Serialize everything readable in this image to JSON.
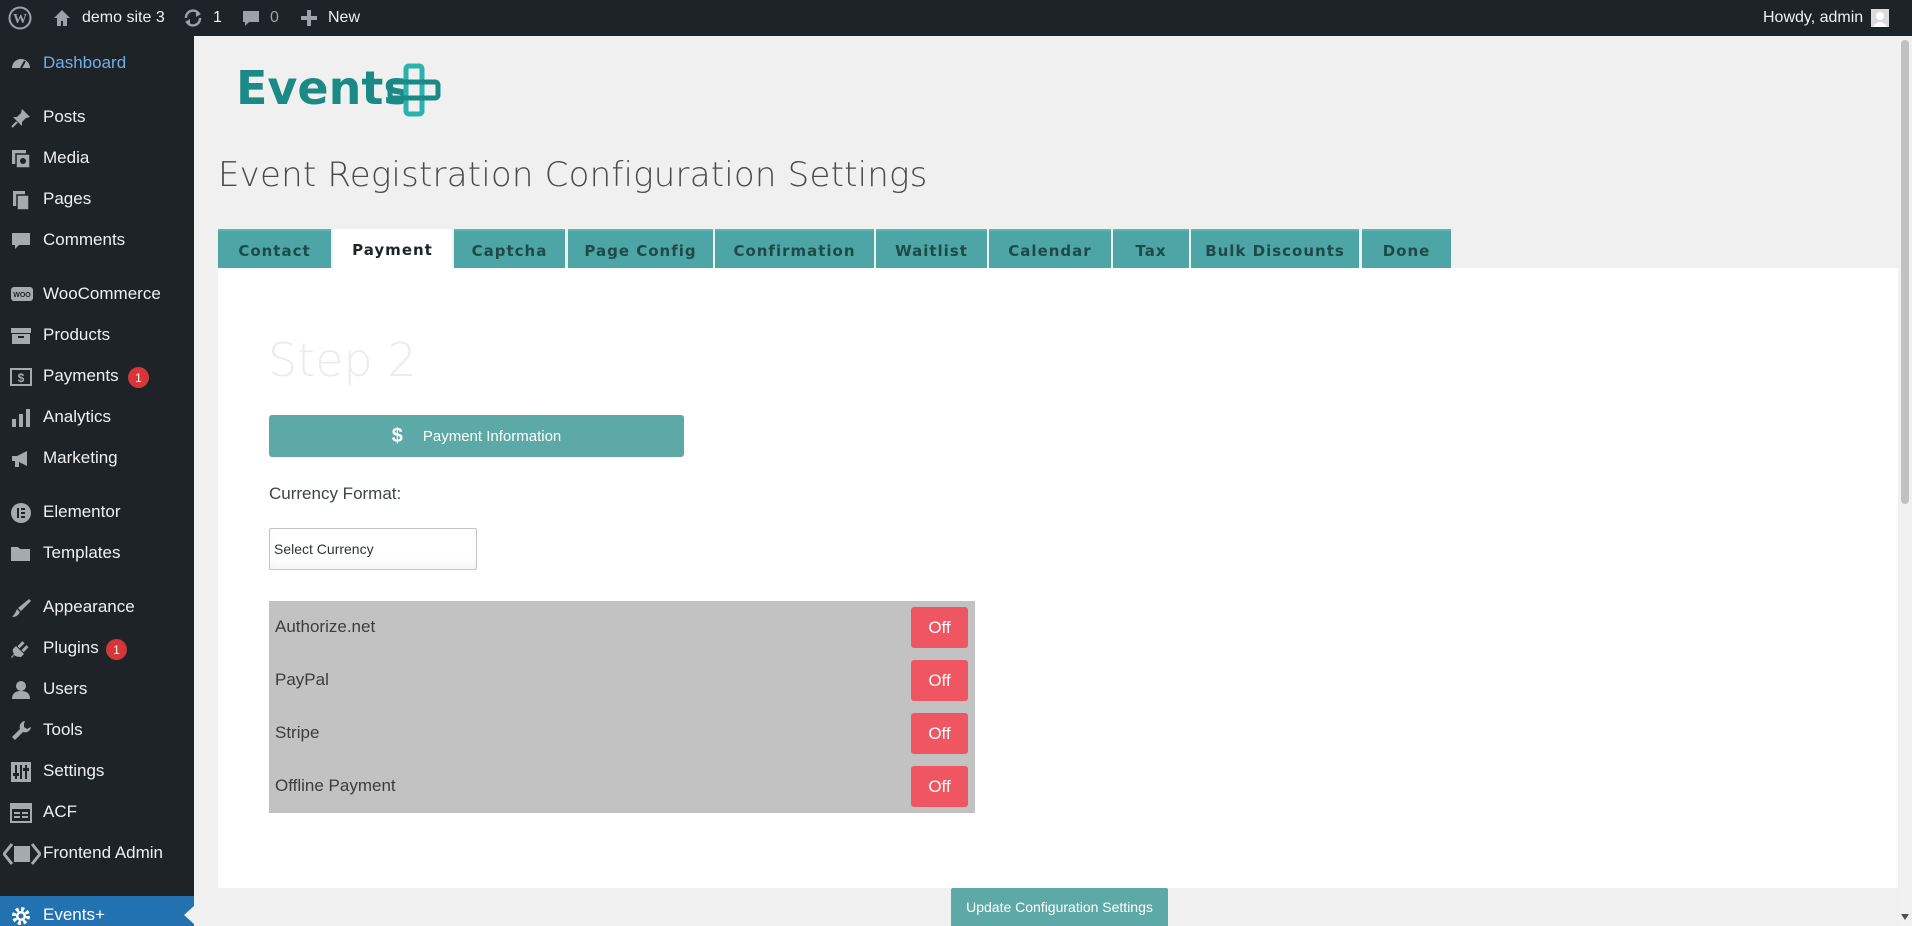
{
  "adminbar": {
    "site_name": "demo site 3",
    "updates_count": "1",
    "comments_count": "0",
    "new_label": "New",
    "howdy": "Howdy, admin"
  },
  "sidebar": {
    "items": [
      {
        "label": "Dashboard",
        "icon": "dashboard-icon"
      },
      {
        "label": "Posts",
        "icon": "pin-icon"
      },
      {
        "label": "Media",
        "icon": "media-icon"
      },
      {
        "label": "Pages",
        "icon": "pages-icon"
      },
      {
        "label": "Comments",
        "icon": "comment-icon"
      },
      {
        "label": "WooCommerce",
        "icon": "woo-icon"
      },
      {
        "label": "Products",
        "icon": "archive-icon"
      },
      {
        "label": "Payments",
        "icon": "money-icon",
        "badge": "1"
      },
      {
        "label": "Analytics",
        "icon": "bar-chart-icon"
      },
      {
        "label": "Marketing",
        "icon": "megaphone-icon"
      },
      {
        "label": "Elementor",
        "icon": "elementor-icon"
      },
      {
        "label": "Templates",
        "icon": "folder-icon"
      },
      {
        "label": "Appearance",
        "icon": "paintbrush-icon"
      },
      {
        "label": "Plugins",
        "icon": "plug-icon",
        "badge": "1"
      },
      {
        "label": "Users",
        "icon": "user-icon"
      },
      {
        "label": "Tools",
        "icon": "wrench-icon"
      },
      {
        "label": "Settings",
        "icon": "settings-icon"
      },
      {
        "label": "ACF",
        "icon": "acf-icon"
      },
      {
        "label": "Frontend Admin",
        "icon": "frontend-admin-icon"
      },
      {
        "label": "Events+",
        "icon": "gear-icon"
      }
    ]
  },
  "logo": {
    "text": "Events",
    "color": "#1b8a86"
  },
  "page_title": "Event Registration Configuration Settings",
  "tabs": [
    "Contact",
    "Payment",
    "Captcha",
    "Page Config",
    "Confirmation",
    "Waitlist",
    "Calendar",
    "Tax",
    "Bulk Discounts",
    "Done"
  ],
  "active_tab": "Payment",
  "step_title": "Step 2",
  "payment_info_label": "Payment Information",
  "currency": {
    "label": "Currency Format:",
    "selected": "Select Currency"
  },
  "gateways": [
    {
      "name": "Authorize.net",
      "state": "Off"
    },
    {
      "name": "PayPal",
      "state": "Off"
    },
    {
      "name": "Stripe",
      "state": "Off"
    },
    {
      "name": "Offline Payment",
      "state": "Off"
    }
  ],
  "update_button": "Update Configuration Settings",
  "colors": {
    "teal": "#5ca9a8",
    "off_red": "#f05662",
    "admin_dark": "#1d2327",
    "wp_blue": "#2271b1"
  }
}
